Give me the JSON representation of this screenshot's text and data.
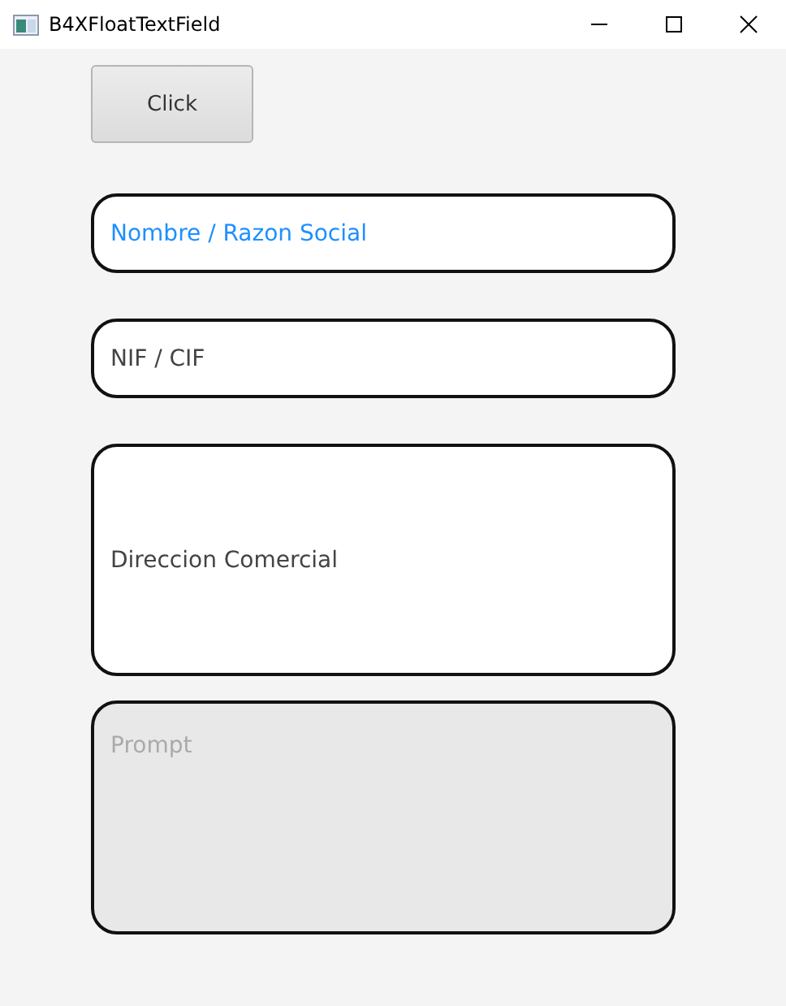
{
  "window": {
    "title": "B4XFloatTextField"
  },
  "button": {
    "label": "Click"
  },
  "fields": [
    {
      "kind": "text",
      "placeholder": "Nombre / Razon Social",
      "focused": true,
      "disabled": false
    },
    {
      "kind": "text",
      "placeholder": "NIF / CIF",
      "focused": false,
      "disabled": false
    },
    {
      "kind": "tall-text",
      "placeholder": "Direccion Comercial",
      "focused": false,
      "disabled": false
    },
    {
      "kind": "text-area",
      "placeholder": "Prompt",
      "focused": false,
      "disabled": true
    }
  ]
}
